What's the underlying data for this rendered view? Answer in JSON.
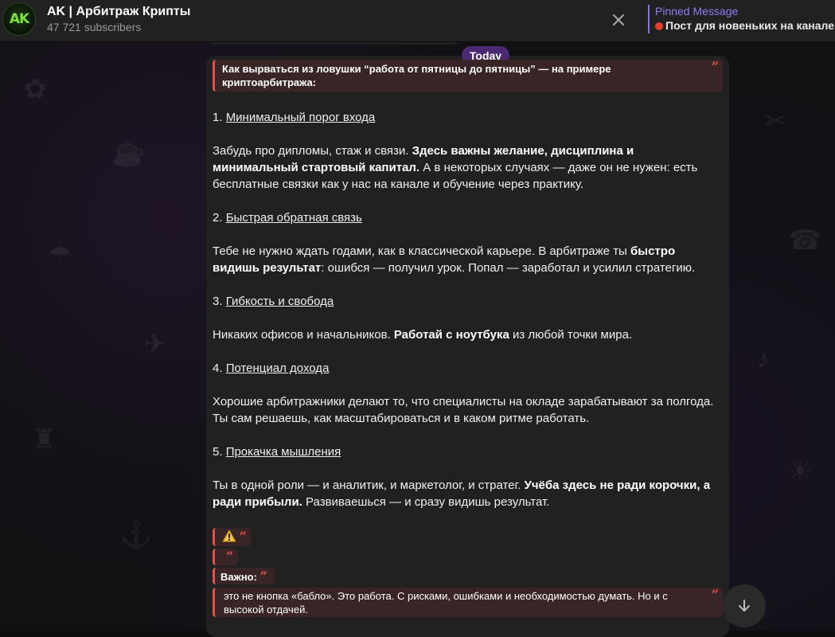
{
  "header": {
    "avatar_text": "AK",
    "title": "AK | Арбитраж Крипты",
    "subscribers": "47 721 subscribers",
    "pinned_label": "Pinned Message",
    "pinned_text": "Пост для новеньких на канале. ..."
  },
  "date_chip": "Today",
  "message": {
    "top_quote": "Как вырваться из ловушки “работа от пятницы до пятницы” — на примере криптоарбитража:",
    "sections": [
      {
        "number": "1.",
        "heading": "Минимальный порог входа",
        "body": [
          {
            "t": "Забудь про дипломы, стаж и связи. ",
            "b": false
          },
          {
            "t": "Здесь важны желание, дисциплина и минимальный стартовый капитал.",
            "b": true
          },
          {
            "t": " А в некоторых случаях — даже он не нужен: есть бесплатные связки как у нас на канале и обучение через практику.",
            "b": false
          }
        ]
      },
      {
        "number": "2.",
        "heading": "Быстрая обратная связь",
        "body": [
          {
            "t": "Тебе не нужно ждать годами, как в классической карьере. В арбитраже ты ",
            "b": false
          },
          {
            "t": "быстро видишь результат",
            "b": true
          },
          {
            "t": ": ошибся — получил урок. Попал — заработал и усилил стратегию.",
            "b": false
          }
        ]
      },
      {
        "number": "3.",
        "heading": "Гибкость и свобода",
        "body": [
          {
            "t": "Никаких офисов и начальников. ",
            "b": false
          },
          {
            "t": "Работай с ноутбука",
            "b": true
          },
          {
            "t": " из любой точки мира.",
            "b": false
          }
        ]
      },
      {
        "number": "4.",
        "heading": "Потенциал дохода",
        "body": [
          {
            "t": "Хорошие арбитражники делают то, что специалисты на окладе зарабатывают за полгода. Ты сам решаешь, как масштабироваться и в каком ритме работать.",
            "b": false
          }
        ]
      },
      {
        "number": "5.",
        "heading": "Прокачка мышления",
        "body": [
          {
            "t": "Ты в одной роли — и аналитик, и маркетолог, и стратег. ",
            "b": false
          },
          {
            "t": "Учёба здесь не ради корочки, а ради прибыли.",
            "b": true
          },
          {
            "t": " Развиваешься — и сразу видишь результат.",
            "b": false
          }
        ]
      }
    ],
    "important_label": "Важно:",
    "bottom_quote": "это не кнопка «бабло». Это работа. С рисками, ошибками и необходимостью думать. Но и с высокой отдачей."
  },
  "colors": {
    "accent": "#8774e1",
    "quote_border": "#e5524a",
    "date_chip": "#4b2a73",
    "bubble": "#212121"
  },
  "icons": {
    "close": "close-icon",
    "warning": "warning-icon",
    "scroll_down": "arrow-down-icon",
    "pin": "pin-dot-icon"
  }
}
